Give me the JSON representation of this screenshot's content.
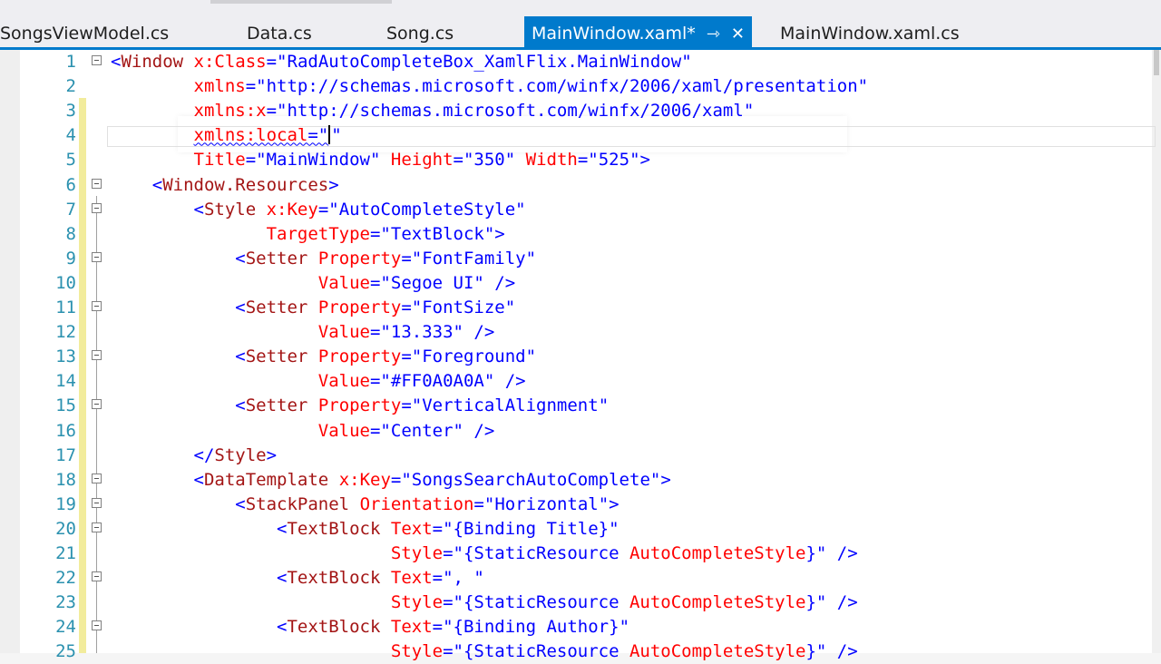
{
  "tabs": [
    {
      "label": "SongsViewModel.cs",
      "active": false
    },
    {
      "label": "Data.cs",
      "active": false
    },
    {
      "label": "Song.cs",
      "active": false
    },
    {
      "label": "MainWindow.xaml*",
      "active": true
    },
    {
      "label": "MainWindow.xaml.cs",
      "active": false
    }
  ],
  "tab_icons": {
    "pin": "pin-icon",
    "close": "close-icon"
  },
  "colors": {
    "accent": "#007acc",
    "line_number": "#2b91af",
    "tag": "#a31515",
    "attribute": "#ff0000",
    "value": "#0000ff",
    "change_bar": "#f2ec9c"
  },
  "lines": [
    {
      "n": "1",
      "indent": "",
      "parts": [
        [
          "p",
          "<"
        ],
        [
          "t",
          "Window "
        ],
        [
          "a",
          "x:Class"
        ],
        [
          "p",
          "=\""
        ],
        [
          "v",
          "RadAutoCompleteBox_XamlFlix.MainWindow"
        ],
        [
          "p",
          "\""
        ]
      ]
    },
    {
      "n": "2",
      "indent": "        ",
      "parts": [
        [
          "a",
          "xmlns"
        ],
        [
          "p",
          "=\""
        ],
        [
          "v",
          "http://schemas.microsoft.com/winfx/2006/xaml/presentation"
        ],
        [
          "p",
          "\""
        ]
      ]
    },
    {
      "n": "3",
      "indent": "        ",
      "parts": [
        [
          "a",
          "xmlns:x"
        ],
        [
          "p",
          "=\""
        ],
        [
          "v",
          "http://schemas.microsoft.com/winfx/2006/xaml"
        ],
        [
          "p",
          "\""
        ]
      ]
    },
    {
      "n": "4",
      "indent": "        ",
      "parts": [
        [
          "as",
          "xmlns:local"
        ],
        [
          "ps",
          "=\""
        ],
        [
          "caret",
          ""
        ],
        [
          "p",
          "\""
        ]
      ]
    },
    {
      "n": "5",
      "indent": "        ",
      "parts": [
        [
          "a",
          "Title"
        ],
        [
          "p",
          "=\""
        ],
        [
          "v",
          "MainWindow"
        ],
        [
          "p",
          "\" "
        ],
        [
          "a",
          "Height"
        ],
        [
          "p",
          "=\""
        ],
        [
          "v",
          "350"
        ],
        [
          "p",
          "\" "
        ],
        [
          "a",
          "Width"
        ],
        [
          "p",
          "=\""
        ],
        [
          "v",
          "525"
        ],
        [
          "p",
          "\">"
        ]
      ]
    },
    {
      "n": "6",
      "indent": "    ",
      "parts": [
        [
          "p",
          "<"
        ],
        [
          "t",
          "Window.Resources"
        ],
        [
          "p",
          ">"
        ]
      ]
    },
    {
      "n": "7",
      "indent": "        ",
      "parts": [
        [
          "p",
          "<"
        ],
        [
          "t",
          "Style "
        ],
        [
          "a",
          "x:Key"
        ],
        [
          "p",
          "=\""
        ],
        [
          "v",
          "AutoCompleteStyle"
        ],
        [
          "p",
          "\""
        ]
      ]
    },
    {
      "n": "8",
      "indent": "               ",
      "parts": [
        [
          "a",
          "TargetType"
        ],
        [
          "p",
          "=\""
        ],
        [
          "v",
          "TextBlock"
        ],
        [
          "p",
          "\">"
        ]
      ]
    },
    {
      "n": "9",
      "indent": "            ",
      "parts": [
        [
          "p",
          "<"
        ],
        [
          "t",
          "Setter "
        ],
        [
          "a",
          "Property"
        ],
        [
          "p",
          "=\""
        ],
        [
          "v",
          "FontFamily"
        ],
        [
          "p",
          "\""
        ]
      ]
    },
    {
      "n": "10",
      "indent": "                    ",
      "parts": [
        [
          "a",
          "Value"
        ],
        [
          "p",
          "=\""
        ],
        [
          "v",
          "Segoe UI"
        ],
        [
          "p",
          "\" />"
        ]
      ]
    },
    {
      "n": "11",
      "indent": "            ",
      "parts": [
        [
          "p",
          "<"
        ],
        [
          "t",
          "Setter "
        ],
        [
          "a",
          "Property"
        ],
        [
          "p",
          "=\""
        ],
        [
          "v",
          "FontSize"
        ],
        [
          "p",
          "\""
        ]
      ]
    },
    {
      "n": "12",
      "indent": "                    ",
      "parts": [
        [
          "a",
          "Value"
        ],
        [
          "p",
          "=\""
        ],
        [
          "v",
          "13.333"
        ],
        [
          "p",
          "\" />"
        ]
      ]
    },
    {
      "n": "13",
      "indent": "            ",
      "parts": [
        [
          "p",
          "<"
        ],
        [
          "t",
          "Setter "
        ],
        [
          "a",
          "Property"
        ],
        [
          "p",
          "=\""
        ],
        [
          "v",
          "Foreground"
        ],
        [
          "p",
          "\""
        ]
      ]
    },
    {
      "n": "14",
      "indent": "                    ",
      "parts": [
        [
          "a",
          "Value"
        ],
        [
          "p",
          "=\""
        ],
        [
          "v",
          "#FF0A0A0A"
        ],
        [
          "p",
          "\" />"
        ]
      ]
    },
    {
      "n": "15",
      "indent": "            ",
      "parts": [
        [
          "p",
          "<"
        ],
        [
          "t",
          "Setter "
        ],
        [
          "a",
          "Property"
        ],
        [
          "p",
          "=\""
        ],
        [
          "v",
          "VerticalAlignment"
        ],
        [
          "p",
          "\""
        ]
      ]
    },
    {
      "n": "16",
      "indent": "                    ",
      "parts": [
        [
          "a",
          "Value"
        ],
        [
          "p",
          "=\""
        ],
        [
          "v",
          "Center"
        ],
        [
          "p",
          "\" />"
        ]
      ]
    },
    {
      "n": "17",
      "indent": "        ",
      "parts": [
        [
          "p",
          "</"
        ],
        [
          "t",
          "Style"
        ],
        [
          "p",
          ">"
        ]
      ]
    },
    {
      "n": "18",
      "indent": "        ",
      "parts": [
        [
          "p",
          "<"
        ],
        [
          "t",
          "DataTemplate "
        ],
        [
          "a",
          "x:Key"
        ],
        [
          "p",
          "=\""
        ],
        [
          "v",
          "SongsSearchAutoComplete"
        ],
        [
          "p",
          "\">"
        ]
      ]
    },
    {
      "n": "19",
      "indent": "            ",
      "parts": [
        [
          "p",
          "<"
        ],
        [
          "t",
          "StackPanel "
        ],
        [
          "a",
          "Orientation"
        ],
        [
          "p",
          "=\""
        ],
        [
          "v",
          "Horizontal"
        ],
        [
          "p",
          "\">"
        ]
      ]
    },
    {
      "n": "20",
      "indent": "                ",
      "parts": [
        [
          "p",
          "<"
        ],
        [
          "t",
          "TextBlock "
        ],
        [
          "a",
          "Text"
        ],
        [
          "p",
          "=\""
        ],
        [
          "v",
          "{Binding Title}"
        ],
        [
          "p",
          "\""
        ]
      ]
    },
    {
      "n": "21",
      "indent": "                           ",
      "parts": [
        [
          "a",
          "Style"
        ],
        [
          "p",
          "=\""
        ],
        [
          "v",
          "{StaticResource "
        ],
        [
          "a",
          "AutoCompleteStyle"
        ],
        [
          "v",
          "}"
        ],
        [
          "p",
          "\" />"
        ]
      ]
    },
    {
      "n": "22",
      "indent": "                ",
      "parts": [
        [
          "p",
          "<"
        ],
        [
          "t",
          "TextBlock "
        ],
        [
          "a",
          "Text"
        ],
        [
          "p",
          "=\""
        ],
        [
          "v",
          ", "
        ],
        [
          "p",
          "\""
        ]
      ]
    },
    {
      "n": "23",
      "indent": "                           ",
      "parts": [
        [
          "a",
          "Style"
        ],
        [
          "p",
          "=\""
        ],
        [
          "v",
          "{StaticResource "
        ],
        [
          "a",
          "AutoCompleteStyle"
        ],
        [
          "v",
          "}"
        ],
        [
          "p",
          "\" />"
        ]
      ]
    },
    {
      "n": "24",
      "indent": "                ",
      "parts": [
        [
          "p",
          "<"
        ],
        [
          "t",
          "TextBlock "
        ],
        [
          "a",
          "Text"
        ],
        [
          "p",
          "=\""
        ],
        [
          "v",
          "{Binding Author}"
        ],
        [
          "p",
          "\""
        ]
      ]
    },
    {
      "n": "25",
      "indent": "                           ",
      "parts": [
        [
          "a",
          "Style"
        ],
        [
          "p",
          "=\""
        ],
        [
          "v",
          "{StaticResource "
        ],
        [
          "a",
          "AutoCompleteStyle"
        ],
        [
          "v",
          "}"
        ],
        [
          "p",
          "\" />"
        ]
      ]
    }
  ]
}
